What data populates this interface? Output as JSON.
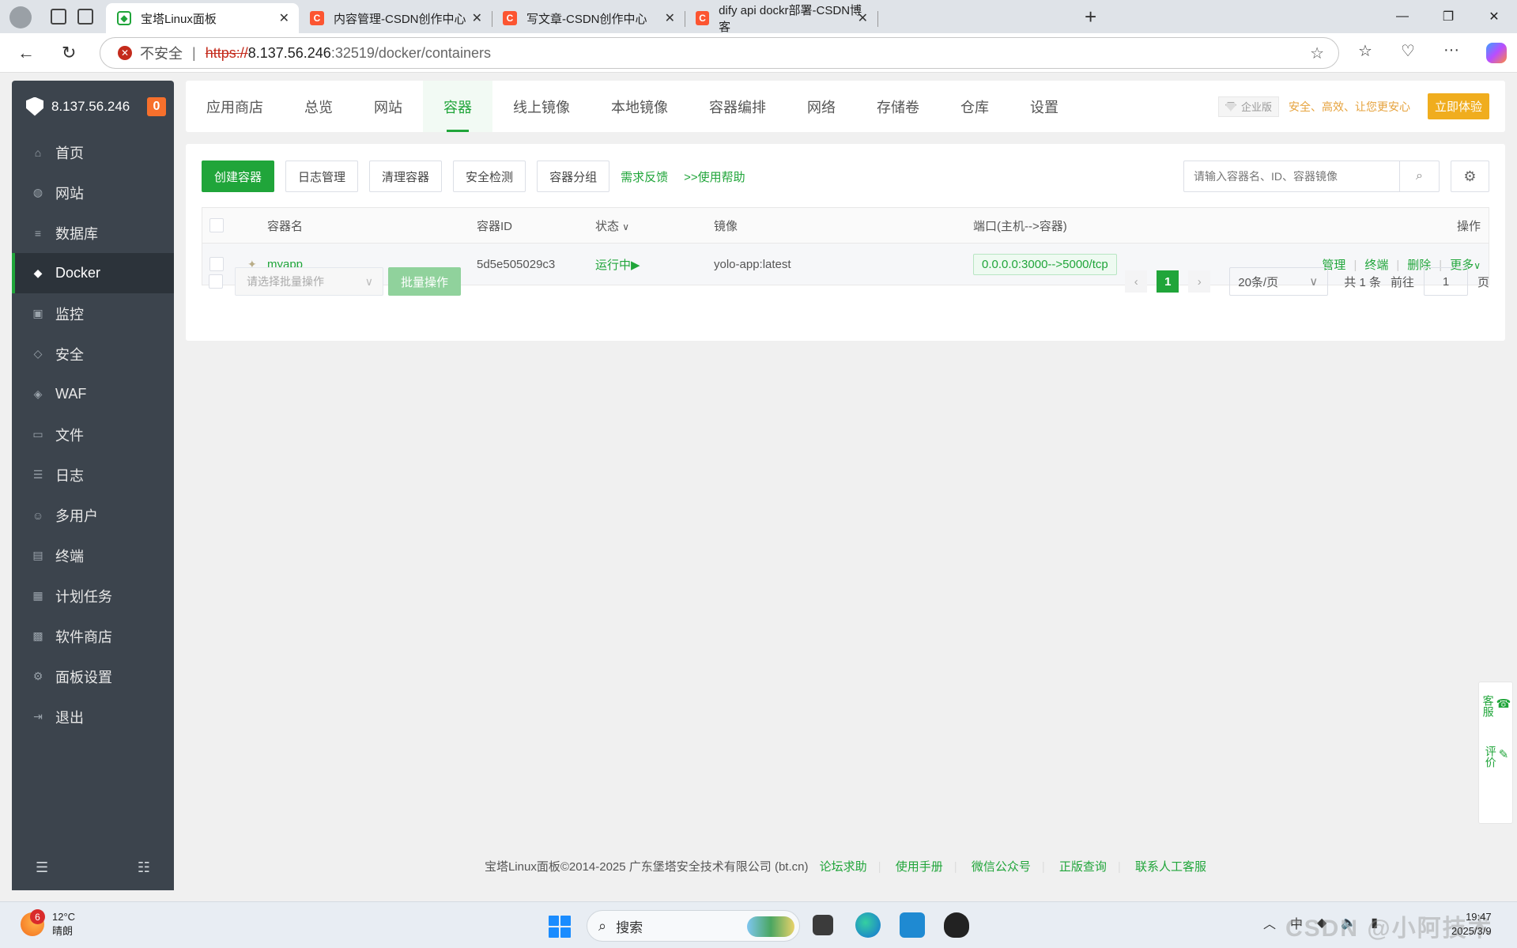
{
  "browser": {
    "tabs": [
      {
        "title": "宝塔Linux面板",
        "active": true,
        "favicon": "bt-shield-icon"
      },
      {
        "title": "内容管理-CSDN创作中心",
        "active": false,
        "favicon": "csdn-icon"
      },
      {
        "title": "写文章-CSDN创作中心",
        "active": false,
        "favicon": "csdn-icon"
      },
      {
        "title": "dify api dockr部署-CSDN博客",
        "active": false,
        "favicon": "csdn-icon"
      }
    ],
    "csdn_glyph": "C",
    "address": {
      "security_label": "不安全",
      "divider": "|",
      "protocol": "https://",
      "host": "8.137.56.246",
      "path": ":32519/docker/containers"
    }
  },
  "sidebar": {
    "server_ip": "8.137.56.246",
    "badge": "0",
    "items": [
      {
        "label": "首页",
        "icon": "home-icon",
        "glyph": "⌂"
      },
      {
        "label": "网站",
        "icon": "globe-icon",
        "glyph": "◍"
      },
      {
        "label": "数据库",
        "icon": "database-icon",
        "glyph": "≡"
      },
      {
        "label": "Docker",
        "icon": "docker-icon",
        "glyph": "◆",
        "active": true
      },
      {
        "label": "监控",
        "icon": "monitor-icon",
        "glyph": "▣"
      },
      {
        "label": "安全",
        "icon": "shield-icon",
        "glyph": "◇"
      },
      {
        "label": "WAF",
        "icon": "waf-icon",
        "glyph": "◈"
      },
      {
        "label": "文件",
        "icon": "folder-icon",
        "glyph": "▭"
      },
      {
        "label": "日志",
        "icon": "log-icon",
        "glyph": "☰"
      },
      {
        "label": "多用户",
        "icon": "users-icon",
        "glyph": "☺"
      },
      {
        "label": "终端",
        "icon": "terminal-icon",
        "glyph": "▤"
      },
      {
        "label": "计划任务",
        "icon": "calendar-icon",
        "glyph": "▦"
      },
      {
        "label": "软件商店",
        "icon": "apps-icon",
        "glyph": "▩"
      },
      {
        "label": "面板设置",
        "icon": "gear-icon",
        "glyph": "⚙"
      },
      {
        "label": "退出",
        "icon": "logout-icon",
        "glyph": "⇥"
      }
    ]
  },
  "topnav": {
    "tabs": [
      "应用商店",
      "总览",
      "网站",
      "容器",
      "线上镜像",
      "本地镜像",
      "容器编排",
      "网络",
      "存储卷",
      "仓库",
      "设置"
    ],
    "active_index": 3,
    "enterprise_label": "企业版",
    "slogan": "安全、高效、让您更安心",
    "try_button": "立即体验"
  },
  "toolbar": {
    "create": "创建容器",
    "logs": "日志管理",
    "clean": "清理容器",
    "security": "安全检测",
    "group": "容器分组",
    "feedback": "需求反馈",
    "help": ">>使用帮助",
    "search_placeholder": "请输入容器名、ID、容器镜像"
  },
  "table": {
    "headers": {
      "name": "容器名",
      "id": "容器ID",
      "status": "状态",
      "image": "镜像",
      "ports": "端口(主机-->容器)",
      "actions": "操作"
    },
    "rows": [
      {
        "name": "myapp",
        "id": "5d5e505029c3",
        "status": "运行中",
        "image": "yolo-app:latest",
        "ports": "0.0.0.0:3000-->5000/tcp",
        "ops": [
          "管理",
          "终端",
          "删除",
          "更多"
        ]
      }
    ]
  },
  "batch": {
    "select_placeholder": "请选择批量操作",
    "button": "批量操作"
  },
  "pagination": {
    "current_page": "1",
    "page_size": "20条/页",
    "total_prefix": "共",
    "total": "1",
    "total_suffix": "条",
    "goto_prefix": "前往",
    "goto_value": "1",
    "goto_suffix": "页"
  },
  "footer": {
    "copyright": "宝塔Linux面板©2014-2025 广东堡塔安全技术有限公司 (bt.cn)",
    "links": [
      "论坛求助",
      "使用手册",
      "微信公众号",
      "正版查询",
      "联系人工客服"
    ]
  },
  "float_panel": {
    "service": "客服",
    "review": "评价"
  },
  "taskbar": {
    "weather_badge": "6",
    "temperature": "12°C",
    "condition": "晴朗",
    "search_label": "搜索",
    "time": "19:47",
    "date": "2025/3/9",
    "watermark": "CSDN @小阿技术"
  },
  "colors": {
    "accent": "#20a53a",
    "sidebar_bg": "#3c444d",
    "badge": "#f7702c",
    "try_button": "#f0ad1e"
  }
}
